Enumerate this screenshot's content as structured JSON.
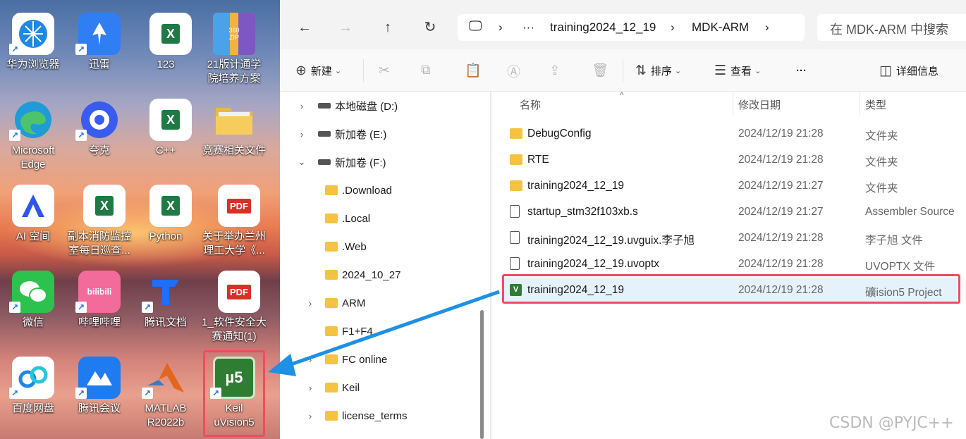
{
  "desktop": {
    "icons": [
      {
        "label": "华为浏览器",
        "icon": "huawei-browser-icon"
      },
      {
        "label": "迅雷",
        "icon": "xunlei-icon"
      },
      {
        "label": "123",
        "icon": "excel-icon"
      },
      {
        "label": "21版计通学\n院培养方案",
        "icon": "zip-archive-icon"
      },
      {
        "label": "Microsoft\nEdge",
        "icon": "edge-icon"
      },
      {
        "label": "夸克",
        "icon": "quark-icon"
      },
      {
        "label": "C++",
        "icon": "excel-icon"
      },
      {
        "label": "竞赛相关文件",
        "icon": "folder-icon"
      },
      {
        "label": "AI 空间",
        "icon": "ai-space-icon"
      },
      {
        "label": "副本消防监控\n室每日巡查...",
        "icon": "excel-icon"
      },
      {
        "label": "Python",
        "icon": "excel-icon"
      },
      {
        "label": "关于举办兰州\n理工大学《...",
        "icon": "pdf-icon"
      },
      {
        "label": "微信",
        "icon": "wechat-icon"
      },
      {
        "label": "哔哩哔哩",
        "icon": "bilibili-icon"
      },
      {
        "label": "腾讯文档",
        "icon": "tencent-docs-icon"
      },
      {
        "label": "1_软件安全大\n赛通知(1)",
        "icon": "pdf-icon"
      },
      {
        "label": "百度网盘",
        "icon": "baidu-netdisk-icon"
      },
      {
        "label": "腾讯会议",
        "icon": "tencent-meeting-icon"
      },
      {
        "label": "MATLAB\nR2022b",
        "icon": "matlab-icon"
      },
      {
        "label": "Keil\nuVision5",
        "icon": "keil-icon"
      }
    ],
    "edge_m": "m",
    "excel_letter": "X",
    "pdf_letter": "PDF",
    "zip_letter": "360\nZIP",
    "bilibili_letter": "bilibili",
    "keil_letter": "µ5"
  },
  "explorer": {
    "address": {
      "ellipsis": "···",
      "crumb1": "training2024_12_19",
      "crumb2": "MDK-ARM"
    },
    "search_placeholder": "在 MDK-ARM 中搜索",
    "toolbar": {
      "new_label": "新建",
      "sort_label": "排序",
      "view_label": "查看",
      "more_label": "···",
      "details_label": "详细信息"
    },
    "nav": [
      {
        "label": "本地磁盘 (D:)",
        "kind": "drive",
        "chev": "›"
      },
      {
        "label": "新加卷 (E:)",
        "kind": "drive",
        "chev": "›"
      },
      {
        "label": "新加卷 (F:)",
        "kind": "drive",
        "chev": "⌄"
      },
      {
        "label": ".Download",
        "kind": "folder",
        "chev": ""
      },
      {
        "label": ".Local",
        "kind": "folder",
        "chev": ""
      },
      {
        "label": ".Web",
        "kind": "folder",
        "chev": ""
      },
      {
        "label": "2024_10_27",
        "kind": "folder",
        "chev": ""
      },
      {
        "label": "ARM",
        "kind": "folder",
        "chev": "›"
      },
      {
        "label": "F1+F4",
        "kind": "folder",
        "chev": ""
      },
      {
        "label": "FC online",
        "kind": "folder",
        "chev": "›"
      },
      {
        "label": "Keil",
        "kind": "folder",
        "chev": "›"
      },
      {
        "label": "license_terms",
        "kind": "folder",
        "chev": "›"
      }
    ],
    "columns": {
      "name": "名称",
      "date": "修改日期",
      "type": "类型"
    },
    "files": [
      {
        "name": "DebugConfig",
        "date": "2024/12/19 21:28",
        "type": "文件夹",
        "icon": "folder"
      },
      {
        "name": "RTE",
        "date": "2024/12/19 21:28",
        "type": "文件夹",
        "icon": "folder"
      },
      {
        "name": "training2024_12_19",
        "date": "2024/12/19 21:27",
        "type": "文件夹",
        "icon": "folder"
      },
      {
        "name": "startup_stm32f103xb.s",
        "date": "2024/12/19 21:27",
        "type": "Assembler Source",
        "icon": "asm"
      },
      {
        "name": "training2024_12_19.uvguix.李子旭",
        "date": "2024/12/19 21:28",
        "type": "李子旭 文件",
        "icon": "doc"
      },
      {
        "name": "training2024_12_19.uvoptx",
        "date": "2024/12/19 21:28",
        "type": "UVOPTX 文件",
        "icon": "doc"
      },
      {
        "name": "training2024_12_19",
        "date": "2024/12/19 21:28",
        "type": "礦ision5 Project",
        "icon": "uv"
      }
    ],
    "uv_letter": "V"
  },
  "watermark": "CSDN @PYJC++",
  "colors": {
    "highlight": "#ee4d5f",
    "arrow": "#1e90e6",
    "selected": "#e5f1fb"
  }
}
